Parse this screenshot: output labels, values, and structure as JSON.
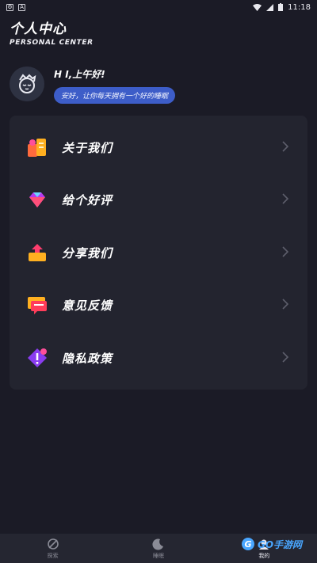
{
  "status": {
    "time": "11:18"
  },
  "header": {
    "title": "个人中心",
    "subtitle": "PERSONAL CENTER"
  },
  "profile": {
    "greeting": "H I,上午好!",
    "message": "安好，让你每天拥有一个好的睡眠"
  },
  "menu": [
    {
      "label": "关于我们",
      "icon": "about-icon"
    },
    {
      "label": "给个好评",
      "icon": "diamond-icon"
    },
    {
      "label": "分享我们",
      "icon": "share-icon"
    },
    {
      "label": "意见反馈",
      "icon": "feedback-icon"
    },
    {
      "label": "隐私政策",
      "icon": "privacy-icon"
    }
  ],
  "tabs": [
    {
      "label": "探索",
      "icon": "explore-icon"
    },
    {
      "label": "睡眠",
      "icon": "moon-icon"
    },
    {
      "label": "我的",
      "icon": "profile-icon"
    }
  ],
  "watermark": {
    "text": "GO手游网"
  }
}
